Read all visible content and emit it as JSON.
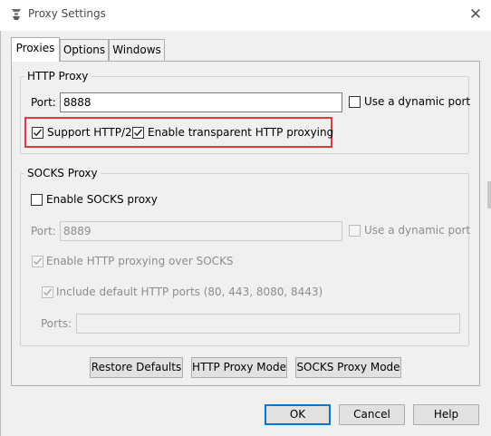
{
  "window": {
    "title": "Proxy Settings",
    "close_glyph": "✕"
  },
  "tabs": [
    {
      "label": "Proxies",
      "active": true
    },
    {
      "label": "Options",
      "active": false
    },
    {
      "label": "Windows",
      "active": false
    }
  ],
  "http_proxy": {
    "legend": "HTTP Proxy",
    "port_label": "Port:",
    "port_value": "8888",
    "dynamic_port": {
      "label": "Use a dynamic port",
      "checked": false
    },
    "support_http2": {
      "label": "Support HTTP/2",
      "checked": true
    },
    "transparent": {
      "label": "Enable transparent HTTP proxying",
      "checked": true
    }
  },
  "socks_proxy": {
    "legend": "SOCKS Proxy",
    "enable": {
      "label": "Enable SOCKS proxy",
      "checked": false
    },
    "port_label": "Port:",
    "port_value": "8889",
    "dynamic_port": {
      "label": "Use a dynamic port",
      "checked": false
    },
    "http_over_socks": {
      "label": "Enable HTTP proxying over SOCKS",
      "checked": true
    },
    "include_default_ports": {
      "label": "Include default HTTP ports (80, 443, 8080, 8443)",
      "checked": true
    },
    "ports_label": "Ports:",
    "ports_value": ""
  },
  "panel_buttons": {
    "restore_defaults": "Restore Defaults",
    "http_proxy_mode": "HTTP Proxy Mode",
    "socks_proxy_mode": "SOCKS Proxy Mode"
  },
  "dialog_buttons": {
    "ok": "OK",
    "cancel": "Cancel",
    "help": "Help"
  },
  "colors": {
    "highlight": "#e33b3b",
    "focus": "#0078d7",
    "disabled_text": "#8d8d8d"
  }
}
